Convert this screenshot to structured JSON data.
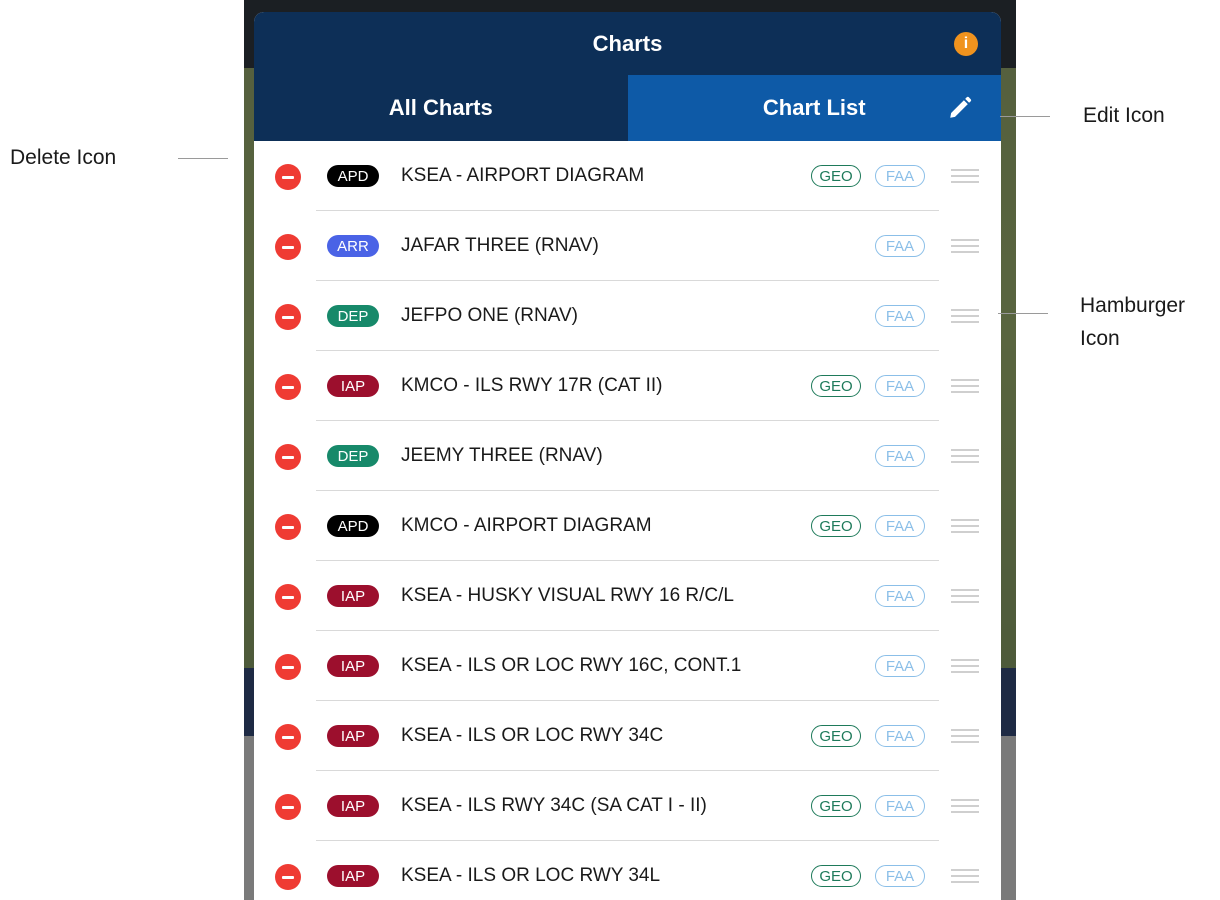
{
  "header": {
    "title": "Charts",
    "info_glyph": "i"
  },
  "tabs": [
    {
      "label": "All Charts",
      "active": false
    },
    {
      "label": "Chart List",
      "active": true
    }
  ],
  "annotations": {
    "delete": "Delete Icon",
    "edit": "Edit Icon",
    "hamburger_line1": "Hamburger",
    "hamburger_line2": "Icon"
  },
  "colors": {
    "header_bg": "#0d2f57",
    "active_tab_bg": "#0e5aa7",
    "delete_red": "#ef3b33",
    "info_orange": "#f0931e",
    "badge_APD": "#000000",
    "badge_ARR": "#4a63e6",
    "badge_DEP": "#17896a",
    "badge_IAP": "#9c0f2d",
    "geo_green": "#1e7a5a",
    "faa_blue": "#8bbfe8"
  },
  "charts": [
    {
      "type": "APD",
      "name": "KSEA - AIRPORT DIAGRAM",
      "geo": "GEO",
      "faa": "FAA"
    },
    {
      "type": "ARR",
      "name": "JAFAR THREE (RNAV)",
      "geo": null,
      "faa": "FAA"
    },
    {
      "type": "DEP",
      "name": "JEFPO ONE (RNAV)",
      "geo": null,
      "faa": "FAA"
    },
    {
      "type": "IAP",
      "name": "KMCO - ILS RWY 17R (CAT II)",
      "geo": "GEO",
      "faa": "FAA"
    },
    {
      "type": "DEP",
      "name": "JEEMY THREE (RNAV)",
      "geo": null,
      "faa": "FAA"
    },
    {
      "type": "APD",
      "name": "KMCO - AIRPORT DIAGRAM",
      "geo": "GEO",
      "faa": "FAA"
    },
    {
      "type": "IAP",
      "name": "KSEA - HUSKY VISUAL RWY 16 R/C/L",
      "geo": null,
      "faa": "FAA"
    },
    {
      "type": "IAP",
      "name": "KSEA - ILS OR LOC RWY 16C, CONT.1",
      "geo": null,
      "faa": "FAA"
    },
    {
      "type": "IAP",
      "name": "KSEA - ILS OR LOC RWY 34C",
      "geo": "GEO",
      "faa": "FAA"
    },
    {
      "type": "IAP",
      "name": "KSEA - ILS RWY 34C (SA CAT I - II)",
      "geo": "GEO",
      "faa": "FAA"
    },
    {
      "type": "IAP",
      "name": "KSEA - ILS OR LOC RWY 34L",
      "geo": "GEO",
      "faa": "FAA"
    }
  ]
}
